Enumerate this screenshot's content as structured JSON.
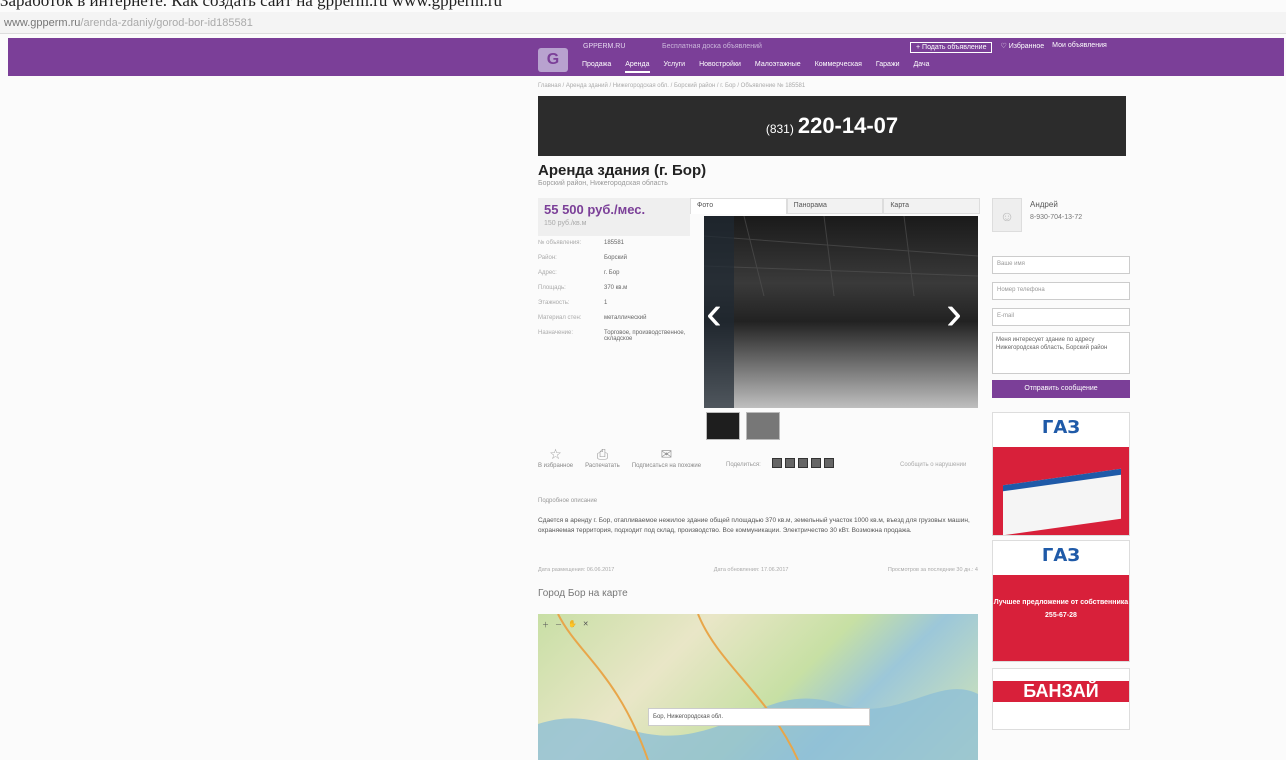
{
  "caption": "Заработок в интернете. Как создать сайт на gpperm.ru www.gpperm.ru",
  "browser": {
    "url_host": "www.gpperm.ru",
    "url_path": "/arenda-zdaniy/gorod-bor-id185581"
  },
  "header": {
    "logo_glyph": "G",
    "brand": "GPPERM.RU",
    "tagline": "Бесплатная доска объявлений",
    "post_button": "+ Подать объявление",
    "favorites": "♡ Избранное",
    "account": "Мои объявления",
    "menu": [
      "Продажа",
      "Аренда",
      "Услуги",
      "Новостройки",
      "Малоэтажные",
      "Коммерческая",
      "Гаражи",
      "Дача"
    ],
    "active_menu_index": 1
  },
  "breadcrumb": "Главная / Аренда зданий / Нижегородская обл. / Борский район / г. Бор / Объявление № 185581",
  "phone_banner": {
    "code": "(831)",
    "number": "220-14-07"
  },
  "listing": {
    "title": "Аренда здания (г. Бор)",
    "subtitle": "Борский район, Нижегородская область",
    "price": "55 500 руб./мес.",
    "price_sub": "150 руб./кв.м",
    "specs": [
      {
        "k": "№ объявления:",
        "v": "185581"
      },
      {
        "k": "Район:",
        "v": "Борский"
      },
      {
        "k": "Адрес:",
        "v": "г. Бор"
      },
      {
        "k": "Площадь:",
        "v": "370 кв.м"
      },
      {
        "k": "Этажность:",
        "v": "1"
      },
      {
        "k": "Материал стен:",
        "v": "металлический"
      },
      {
        "k": "Назначение:",
        "v": "Торговое, производственное, складское"
      }
    ],
    "tabs": [
      "Фото",
      "Панорама",
      "Карта"
    ],
    "actions": [
      {
        "icon": "☆",
        "label": "В избранное"
      },
      {
        "icon": "⎙",
        "label": "Распечатать"
      },
      {
        "icon": "✉",
        "label": "Подписаться на похожие"
      }
    ],
    "share_label": "Поделиться:",
    "complaint": "Сообщить о нарушении",
    "description_head": "Подробное описание",
    "description": "Сдается в аренду г. Бор, отапливаемое нежилое здание общей площадью 370 кв.м, земельный участок 1000 кв.м, въезд для грузовых машин, охраняемая территория, подходит под склад, производство. Все коммуникации. Электричество 30 кВт. Возможна продажа.",
    "meta_left": "Дата размещения: 06.06.2017",
    "meta_mid": "Дата обновления: 17.06.2017",
    "meta_right": "Просмотров за последние 30 дн.: 4",
    "map_title": "Город Бор на карте",
    "map_search": "Бор, Нижегородская обл."
  },
  "sidebar": {
    "avatar_icon": "person-icon",
    "contact_name": "Андрей",
    "contact_phone": "8-930-704-13-72",
    "name_placeholder": "Ваше имя",
    "phone_placeholder": "Номер телефона",
    "email_placeholder": "E-mail",
    "message": "Меня интересует здание по адресу Нижегородская область, Борский район",
    "send_button": "Отправить сообщение",
    "ad1_logo": "ГАЗ",
    "ad2_logo": "ГАЗ",
    "ad2_text": "Лучшее предложение от собственника",
    "ad2_phone": "255-67-28",
    "ad3_text": "БАНЗАЙ"
  },
  "colors": {
    "brand": "#7b3f98",
    "ad_red": "#d8203a",
    "gaz_blue": "#1f5aa8"
  }
}
